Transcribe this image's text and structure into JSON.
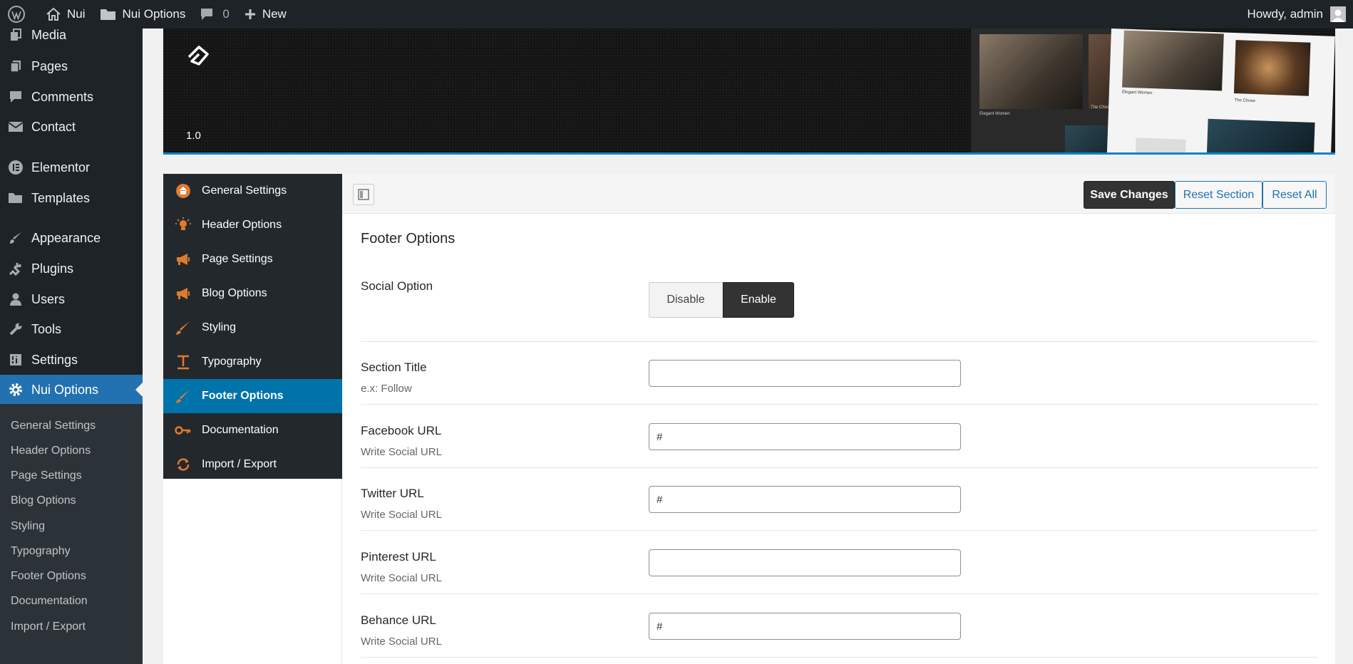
{
  "admin_bar": {
    "site_name": "Nui",
    "options_link": "Nui Options",
    "comment_count": "0",
    "new_label": "New",
    "greeting": "Howdy, admin"
  },
  "admin_menu": {
    "items": [
      {
        "label": "Media",
        "icon": "media-icon"
      },
      {
        "label": "Pages",
        "icon": "pages-icon"
      },
      {
        "label": "Comments",
        "icon": "comments-icon"
      },
      {
        "label": "Contact",
        "icon": "contact-icon"
      },
      {
        "label": "Elementor",
        "icon": "elementor-icon"
      },
      {
        "label": "Templates",
        "icon": "templates-icon"
      },
      {
        "label": "Appearance",
        "icon": "appearance-icon"
      },
      {
        "label": "Plugins",
        "icon": "plugins-icon"
      },
      {
        "label": "Users",
        "icon": "users-icon"
      },
      {
        "label": "Tools",
        "icon": "tools-icon"
      },
      {
        "label": "Settings",
        "icon": "settings-icon"
      },
      {
        "label": "Nui Options",
        "icon": "gear-icon"
      }
    ],
    "submenu": [
      "General Settings",
      "Header Options",
      "Page Settings",
      "Blog Options",
      "Styling",
      "Typography",
      "Footer Options",
      "Documentation",
      "Import / Export"
    ]
  },
  "banner": {
    "version": "1.0",
    "thumb_captions": [
      "Elegant Women",
      "The Chose",
      "Elegant Women",
      "The Chose"
    ]
  },
  "options_nav": {
    "items": [
      {
        "label": "General Settings",
        "icon": "home-icon"
      },
      {
        "label": "Header Options",
        "icon": "lightbulb-icon"
      },
      {
        "label": "Page Settings",
        "icon": "megaphone-icon"
      },
      {
        "label": "Blog Options",
        "icon": "megaphone-icon"
      },
      {
        "label": "Styling",
        "icon": "brush-icon"
      },
      {
        "label": "Typography",
        "icon": "text-icon"
      },
      {
        "label": "Footer Options",
        "icon": "brush-icon"
      },
      {
        "label": "Documentation",
        "icon": "key-icon"
      },
      {
        "label": "Import / Export",
        "icon": "refresh-icon"
      }
    ],
    "active": "Footer Options"
  },
  "toolbar": {
    "save_label": "Save Changes",
    "reset_section_label": "Reset Section",
    "reset_all_label": "Reset All"
  },
  "section": {
    "title": "Footer Options",
    "social_option": {
      "label": "Social Option",
      "options": [
        "Disable",
        "Enable"
      ],
      "selected": "Enable"
    },
    "fields": [
      {
        "label": "Section Title",
        "desc": "e.x: Follow",
        "value": ""
      },
      {
        "label": "Facebook URL",
        "desc": "Write Social URL",
        "value": "#"
      },
      {
        "label": "Twitter URL",
        "desc": "Write Social URL",
        "value": "#"
      },
      {
        "label": "Pinterest URL",
        "desc": "Write Social URL",
        "value": ""
      },
      {
        "label": "Behance URL",
        "desc": "Write Social URL",
        "value": "#"
      }
    ]
  },
  "colors": {
    "admin_dark": "#1d2327",
    "admin_blue": "#2271b1",
    "nav_active": "#0073aa",
    "icon_orange": "#e07a2e"
  }
}
